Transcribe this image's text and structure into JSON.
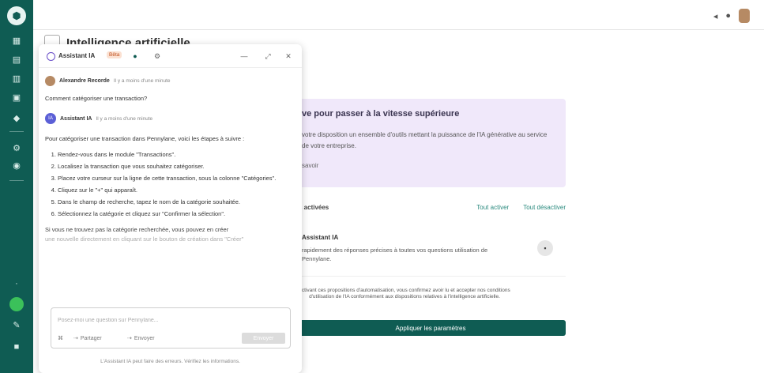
{
  "rail": {
    "logo": "⬢"
  },
  "page": {
    "title": "Intelligence artificielle"
  },
  "promo": {
    "title": "ve pour passer à la vitesse supérieure",
    "body": "votre disposition un ensemble d'outils mettant la puissance de l'IA générative au service de votre entreprise.",
    "more": "savoir"
  },
  "features": {
    "heading": "s activées",
    "activate_all": "Tout activer",
    "deactivate_all": "Tout désactiver",
    "assistant": {
      "name": "Assistant IA",
      "description": "rapidement des réponses précises à toutes vos questions utilisation de Pennylane."
    }
  },
  "legal": "activant ces propositions d'automatisation, vous confirmez avoir lu et accepter nos conditions d'utilisation de l'IA conformément aux dispositions relatives à l'intelligence artificielle.",
  "apply_button": "Appliquer les paramètres",
  "chat": {
    "title": "Assistant IA",
    "badge": "Bêta",
    "user_name": "Alexandre Recorde",
    "user_time": "Il y a moins d'une minute",
    "question": "Comment catégoriser une transaction?",
    "ai_name": "Assistant IA",
    "ai_time": "Il y a moins d'une minute",
    "intro": "Pour catégoriser une transaction dans Pennylane, voici les étapes à suivre :",
    "steps": [
      "Rendez-vous dans le module \"Transactions\".",
      "Localisez la transaction que vous souhaitez catégoriser.",
      "Placez votre curseur sur la ligne de cette transaction, sous la colonne \"Catégories\".",
      "Cliquez sur le \"+\" qui apparaît.",
      "Dans le champ de recherche, tapez le nom de la catégorie souhaitée.",
      "Sélectionnez la catégorie et cliquez sur \"Confirmer la sélection\"."
    ],
    "follow": "Si vous ne trouvez pas la catégorie recherchée, vous pouvez en créer",
    "follow_faded": "une nouvelle directement en cliquant sur le bouton de création dans \"Créer\"",
    "input_placeholder": "Posez-moi une question sur Pennylane...",
    "attach": "Partager",
    "record": "Envoyer",
    "send": "Envoyer",
    "footnote": "L'Assistant IA peut faire des erreurs. Vérifiez les informations."
  }
}
